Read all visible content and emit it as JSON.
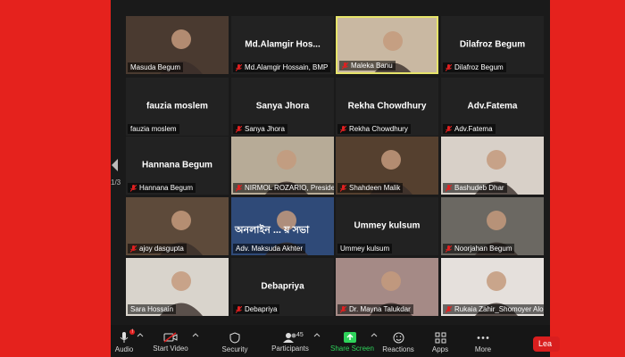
{
  "page_indicator": "1/3",
  "tiles": [
    {
      "name": "Masuda Begum",
      "type": "video",
      "muted": false
    },
    {
      "name": "Md.Alamgir Hossain, BMP",
      "center_name": "Md.Alamgir  Hos...",
      "type": "name",
      "muted": true
    },
    {
      "name": "Maleka Banu",
      "type": "video",
      "muted": true,
      "active": true
    },
    {
      "name": "Dilafroz Begum",
      "center_name": "Dilafroz Begum",
      "type": "name",
      "muted": true
    },
    {
      "name": "fauzia moslem",
      "center_name": "fauzia moslem",
      "type": "name",
      "muted": false
    },
    {
      "name": "Sanya Jhora",
      "center_name": "Sanya Jhora",
      "type": "name",
      "muted": true
    },
    {
      "name": "Rekha Chowdhury",
      "center_name": "Rekha Chowdhury",
      "type": "name",
      "muted": true
    },
    {
      "name": "Adv.Fatema",
      "center_name": "Adv.Fatema",
      "type": "name",
      "muted": true
    },
    {
      "name": "Hannana Begum",
      "center_name": "Hannana Begum",
      "type": "name",
      "muted": true
    },
    {
      "name": "NIRMOL ROZARIO, President",
      "type": "video",
      "muted": true
    },
    {
      "name": "Shahdeen Malik",
      "type": "video",
      "muted": true
    },
    {
      "name": "Bashudeb Dhar",
      "type": "video",
      "muted": true
    },
    {
      "name": "ajoy dasgupta",
      "type": "video",
      "muted": true
    },
    {
      "name": "Adv. Maksuda Akhter",
      "type": "video",
      "muted": false,
      "banner_text": "অনলাইন ... য় সভা"
    },
    {
      "name": "Ummey kulsum",
      "center_name": "Ummey kulsum",
      "type": "name",
      "muted": false
    },
    {
      "name": "Noorjahan Begum",
      "type": "video",
      "muted": true
    },
    {
      "name": "Sara Hossain",
      "type": "video",
      "muted": false
    },
    {
      "name": "Debapriya",
      "center_name": "Debapriya",
      "type": "name",
      "muted": true
    },
    {
      "name": "Dr. Mayna Talukdar",
      "type": "video",
      "muted": true
    },
    {
      "name": "Rukaia Zahir_Shomoyer Alo",
      "type": "video",
      "muted": true
    }
  ],
  "toolbar": {
    "audio": "Audio",
    "start_video": "Start Video",
    "security": "Security",
    "participants": "Participants",
    "participants_count": "45",
    "share_screen": "Share Screen",
    "reactions": "Reactions",
    "apps": "Apps",
    "more": "More",
    "leave": "Lea",
    "audio_badge": "!"
  },
  "colors": {
    "active_border": "#e6e46a",
    "share_green": "#2fd35b",
    "leave_red": "#d91e1e",
    "frame_red": "#e5221d"
  }
}
